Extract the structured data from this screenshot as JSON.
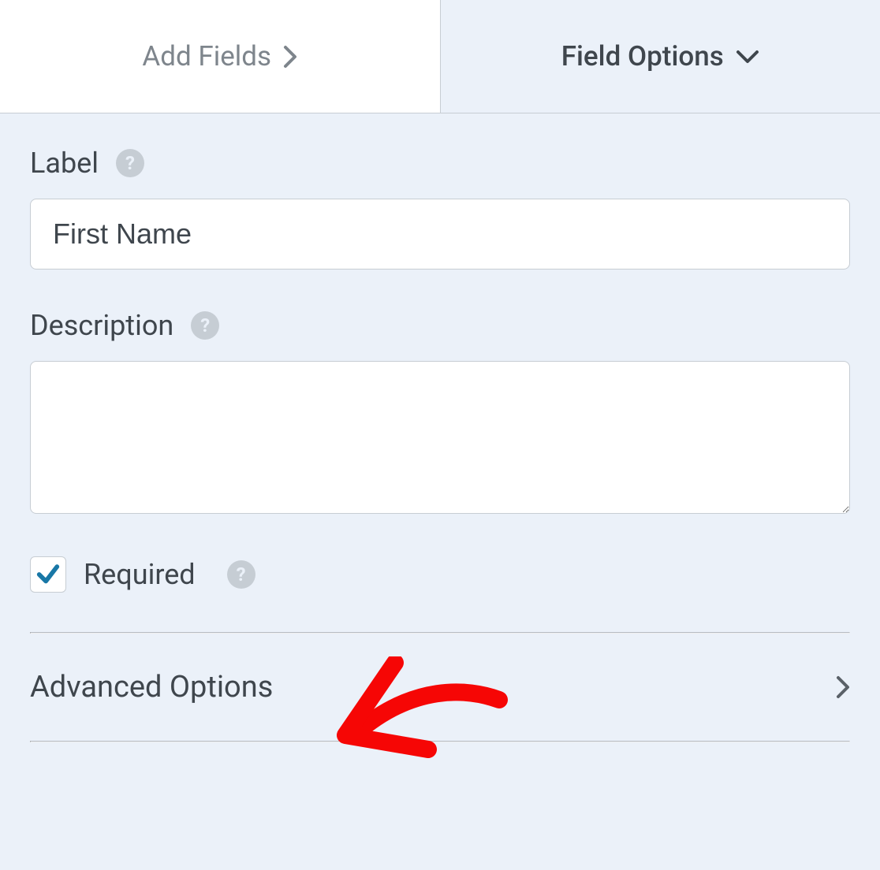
{
  "tabs": {
    "add_fields": "Add Fields",
    "field_options": "Field Options"
  },
  "fields": {
    "label": {
      "title": "Label",
      "value": "First Name"
    },
    "description": {
      "title": "Description",
      "value": ""
    },
    "required": {
      "label": "Required",
      "checked": true
    }
  },
  "sections": {
    "advanced_options": "Advanced Options"
  }
}
